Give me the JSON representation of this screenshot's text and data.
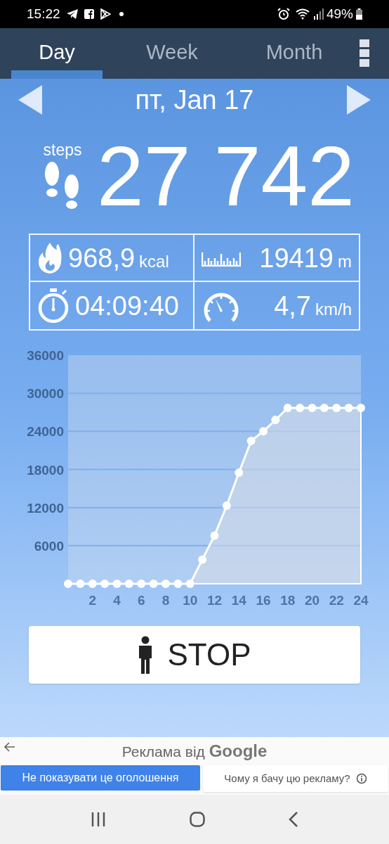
{
  "status_bar": {
    "time": "15:22",
    "battery": "49%"
  },
  "tabs": [
    {
      "label": "Day",
      "selected": true
    },
    {
      "label": "Week",
      "selected": false
    },
    {
      "label": "Month",
      "selected": false
    }
  ],
  "date": "пт, Jan 17",
  "steps": {
    "label": "steps",
    "value": "27 742"
  },
  "stats": [
    {
      "kind": "calories",
      "value": "968,9",
      "unit": "kcal"
    },
    {
      "kind": "distance",
      "value": "19419",
      "unit": "m"
    },
    {
      "kind": "time",
      "value": "04:09:40"
    },
    {
      "kind": "speed",
      "value": "4,7",
      "unit": "km/h"
    }
  ],
  "chart_data": {
    "type": "area",
    "x": [
      0,
      1,
      2,
      3,
      4,
      5,
      6,
      7,
      8,
      9,
      10,
      11,
      12,
      13,
      14,
      15,
      16,
      17,
      18,
      19,
      20,
      21,
      22,
      23,
      24
    ],
    "series": [
      {
        "color": "#ffffff",
        "values": [
          0,
          0,
          0,
          0,
          0,
          0,
          0,
          0,
          0,
          0,
          0,
          3800,
          7600,
          12300,
          17500,
          22500,
          24000,
          25800,
          27700,
          27700,
          27700,
          27700,
          27700,
          27700,
          27700
        ]
      }
    ],
    "grid": true,
    "xlim": [
      0,
      24
    ],
    "ylim": [
      0,
      36000
    ],
    "xticks": [
      2,
      4,
      6,
      8,
      10,
      12,
      14,
      16,
      18,
      20,
      22,
      24
    ],
    "yticks": [
      6000,
      12000,
      18000,
      24000,
      30000,
      36000
    ]
  },
  "stop_button": {
    "label": "STOP"
  },
  "ad": {
    "title": "Реклама від **Google**",
    "hide_button": "Не показувати це оголошення",
    "why_button": "Чому я бачу цю рекламу?"
  }
}
